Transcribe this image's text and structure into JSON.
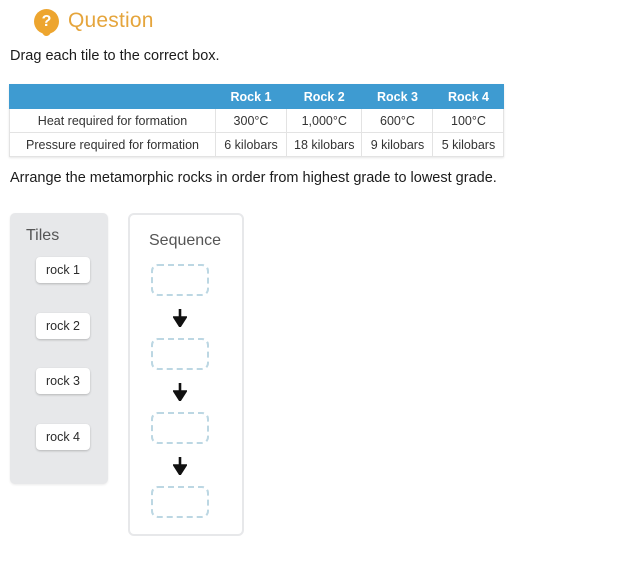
{
  "header": {
    "icon": "question-badge-icon",
    "qmark": "?",
    "title": "Question",
    "title_color": "#e5a53c",
    "badge_color": "#eda52f"
  },
  "prompts": {
    "drag": "Drag each tile to the correct box.",
    "arrange": "Arrange the metamorphic rocks in order from highest grade to lowest grade."
  },
  "table": {
    "header_color": "#3e9bd1",
    "corner_label": "",
    "columns": [
      "Rock 1",
      "Rock 2",
      "Rock 3",
      "Rock 4"
    ],
    "rows": [
      {
        "label": "Heat required for formation",
        "values": [
          "300°C",
          "1,000°C",
          "600°C",
          "100°C"
        ]
      },
      {
        "label": "Pressure required for formation",
        "values": [
          "6 kilobars",
          "18 kilobars",
          "9 kilobars",
          "5 kilobars"
        ]
      }
    ]
  },
  "tiles_panel": {
    "title": "Tiles",
    "tiles": [
      {
        "label": "rock 1"
      },
      {
        "label": "rock 2"
      },
      {
        "label": "rock 3"
      },
      {
        "label": "rock 4"
      }
    ]
  },
  "sequence_panel": {
    "title": "Sequence",
    "slots": [
      {
        "value": ""
      },
      {
        "value": ""
      },
      {
        "value": ""
      },
      {
        "value": ""
      }
    ],
    "arrows": [
      "down-arrow-icon",
      "down-arrow-icon",
      "down-arrow-icon"
    ],
    "dropbox_border_color": "#bcd7e3"
  }
}
